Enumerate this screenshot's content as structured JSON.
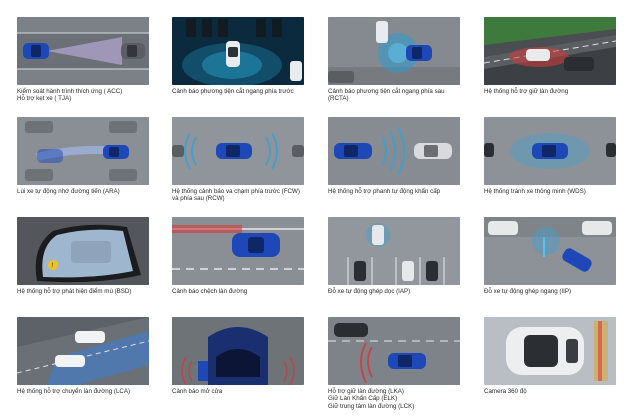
{
  "features": [
    {
      "id": "acc",
      "lines": [
        "Kiểm soát hành trình thích ứng ( ACC)",
        "Hỗ trợ kẹt xe ( TJA)"
      ]
    },
    {
      "id": "fcta",
      "lines": [
        "Cảnh báo phương tiện cắt ngang phía trước"
      ]
    },
    {
      "id": "rcta",
      "lines": [
        "Cảnh báo phương tiện cắt ngang phía sau",
        "(RCTA)"
      ]
    },
    {
      "id": "lka",
      "lines": [
        "Hệ thống hỗ trợ giữ làn đường"
      ]
    },
    {
      "id": "ara",
      "lines": [
        "Lùi xe tự động nhớ đường tiến (ARA)"
      ]
    },
    {
      "id": "fcw",
      "lines": [
        "Hệ thống cảnh báo va chạm phía trước (FCW)",
        "và phía sau (RCW)"
      ]
    },
    {
      "id": "aeb",
      "lines": [
        "Hệ thống hỗ trợ phanh tự động khẩn cấp"
      ]
    },
    {
      "id": "wds",
      "lines": [
        "Hệ thống tránh xe  thông minh (WDS)"
      ]
    },
    {
      "id": "bsd",
      "lines": [
        "Hệ thống hỗ trợ phát hiện điểm mù (BSD)"
      ]
    },
    {
      "id": "ldw",
      "lines": [
        "Cảnh báo chệch làn đường"
      ]
    },
    {
      "id": "iap",
      "lines": [
        "Đỗ xe tự động ghép dọc (IAP)"
      ]
    },
    {
      "id": "iip",
      "lines": [
        "Đỗ xe tự động ghép ngang (IIP)"
      ]
    },
    {
      "id": "lca",
      "lines": [
        "Hệ thống hỗ trợ chuyển làn đường (LCA)"
      ]
    },
    {
      "id": "door",
      "lines": [
        "Cảnh báo mở cửa"
      ]
    },
    {
      "id": "lkc",
      "lines": [
        "Hỗ trợ giữ làn đường (LKA)",
        "Giữ Làn Khẩn Cấp (ELK)",
        "Giữ trung tâm làn đường (LCK)"
      ]
    },
    {
      "id": "cam360",
      "lines": [
        "Camera 360 độ"
      ]
    }
  ]
}
